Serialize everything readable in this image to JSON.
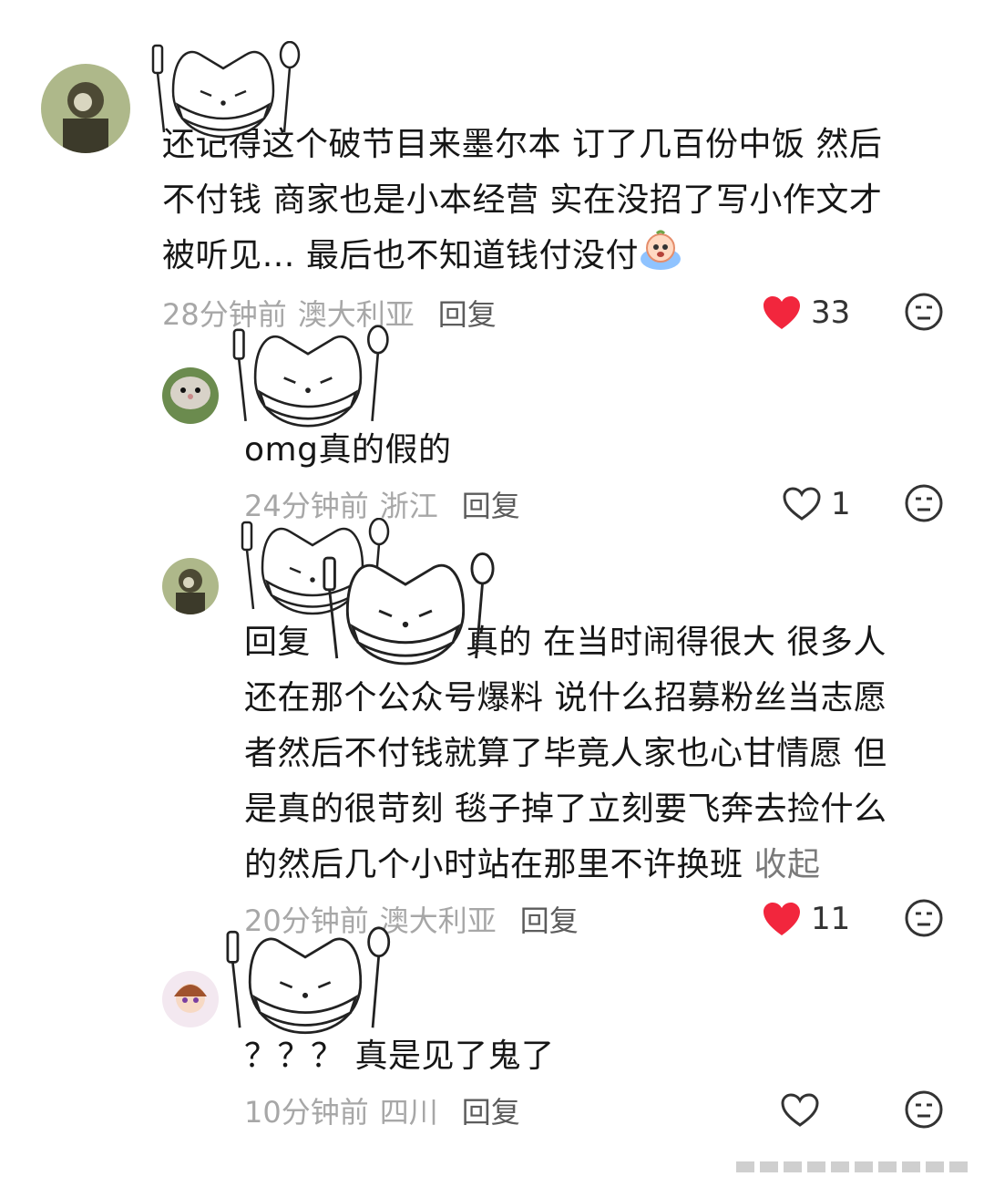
{
  "comments": [
    {
      "lines": [
        "还记得这个破节目来墨尔本 订了几百份中饭  然后",
        "不付钱  商家也是小本经营 实在没招了写小作文才",
        "被听见… 最后也不知道钱付没付"
      ],
      "emoji": "crying-face-emoji",
      "time": "28分钟前",
      "location": "澳大利亚",
      "reply_label": "回复",
      "likes": "33",
      "liked": true
    },
    {
      "lines": [
        "omg真的假的"
      ],
      "time": "24分钟前",
      "location": "浙江",
      "reply_label": "回复",
      "likes": "1",
      "liked": false
    },
    {
      "lines": [
        "回复",
        "还在那个公众号爆料 说什么招募粉丝当志愿",
        "者然后不付钱就算了毕竟人家也心甘情愿 但",
        "是真的很苛刻 毯子掉了立刻要飞奔去捡什么",
        "的然后几个小时站在那里不许换班"
      ],
      "line1_tail": "真的 在当时闹得很大 很多人",
      "collapse_label": "收起",
      "time": "20分钟前",
      "location": "澳大利亚",
      "reply_label": "回复",
      "likes": "11",
      "liked": true
    },
    {
      "lines": [
        "？？？ 真是见了鬼了"
      ],
      "time": "10分钟前",
      "location": "四川",
      "reply_label": "回复",
      "likes": "",
      "liked": false
    }
  ],
  "colors": {
    "heart": "#f2263d",
    "text": "#161616",
    "meta": "#a7a7a7",
    "reply": "#5c5c5c"
  }
}
